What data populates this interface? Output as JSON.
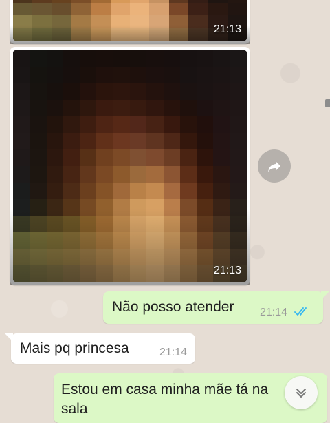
{
  "chat": {
    "image_messages": [
      {
        "time": "21:13",
        "type": "received-image"
      },
      {
        "time": "21:13",
        "type": "received-image"
      }
    ],
    "messages": [
      {
        "direction": "sent",
        "text": "Não posso atender",
        "time": "21:14",
        "status": "read"
      },
      {
        "direction": "received",
        "text": "Mais pq princesa",
        "time": "21:14"
      },
      {
        "direction": "sent",
        "text": "Estou em casa minha mãe tá na sala"
      }
    ],
    "controls": {
      "forward_icon": "forward-arrow-icon",
      "scroll_down_icon": "double-chevron-down-icon"
    },
    "colors": {
      "wallpaper": "#e6ddd4",
      "sent_bubble": "#dcf8c6",
      "received_bubble": "#ffffff",
      "read_ticks": "#34b7f1"
    }
  }
}
